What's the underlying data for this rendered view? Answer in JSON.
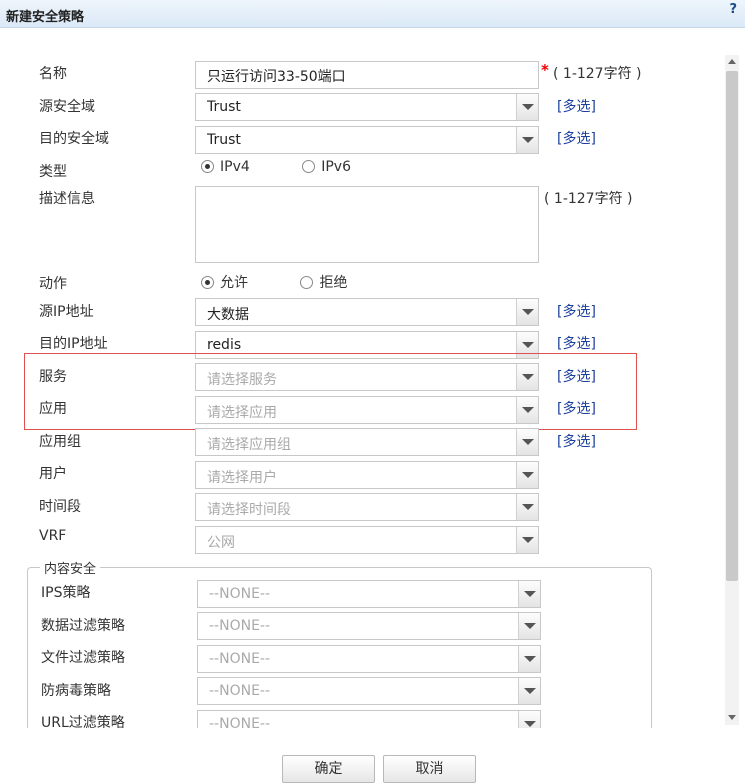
{
  "dialog": {
    "title": "新建安全策略",
    "help": "?"
  },
  "form": {
    "name": {
      "label": "名称",
      "value": "只运行访问33-50端口",
      "required_mark": "*",
      "hint": "( 1-127字符 )"
    },
    "src_zone": {
      "label": "源安全域",
      "value": "Trust",
      "multi": "[多选]"
    },
    "dst_zone": {
      "label": "目的安全域",
      "value": "Trust",
      "multi": "[多选]"
    },
    "type": {
      "label": "类型",
      "options": [
        "IPv4",
        "IPv6"
      ],
      "selected": "IPv4"
    },
    "description": {
      "label": "描述信息",
      "hint": "( 1-127字符 )"
    },
    "action": {
      "label": "动作",
      "options": [
        "允许",
        "拒绝"
      ],
      "selected": "允许"
    },
    "src_ip": {
      "label": "源IP地址",
      "value": "大数据",
      "multi": "[多选]"
    },
    "dst_ip": {
      "label": "目的IP地址",
      "value": "redis",
      "multi": "[多选]"
    },
    "service": {
      "label": "服务",
      "placeholder": "请选择服务",
      "multi": "[多选]"
    },
    "application": {
      "label": "应用",
      "placeholder": "请选择应用",
      "multi": "[多选]"
    },
    "app_group": {
      "label": "应用组",
      "placeholder": "请选择应用组",
      "multi": "[多选]"
    },
    "user": {
      "label": "用户",
      "placeholder": "请选择用户"
    },
    "time_range": {
      "label": "时间段",
      "placeholder": "请选择时间段"
    },
    "vrf": {
      "label": "VRF",
      "placeholder": "公网"
    }
  },
  "content_security": {
    "legend": "内容安全",
    "rows": [
      {
        "label": "IPS策略",
        "value": "--NONE--"
      },
      {
        "label": "数据过滤策略",
        "value": "--NONE--"
      },
      {
        "label": "文件过滤策略",
        "value": "--NONE--"
      },
      {
        "label": "防病毒策略",
        "value": "--NONE--"
      },
      {
        "label": "URL过滤策略",
        "value": "--NONE--"
      }
    ]
  },
  "buttons": {
    "ok": "确定",
    "cancel": "取消"
  },
  "colors": {
    "link": "#1b3f9c",
    "highlight": "#e05050",
    "required": "#e00000"
  }
}
